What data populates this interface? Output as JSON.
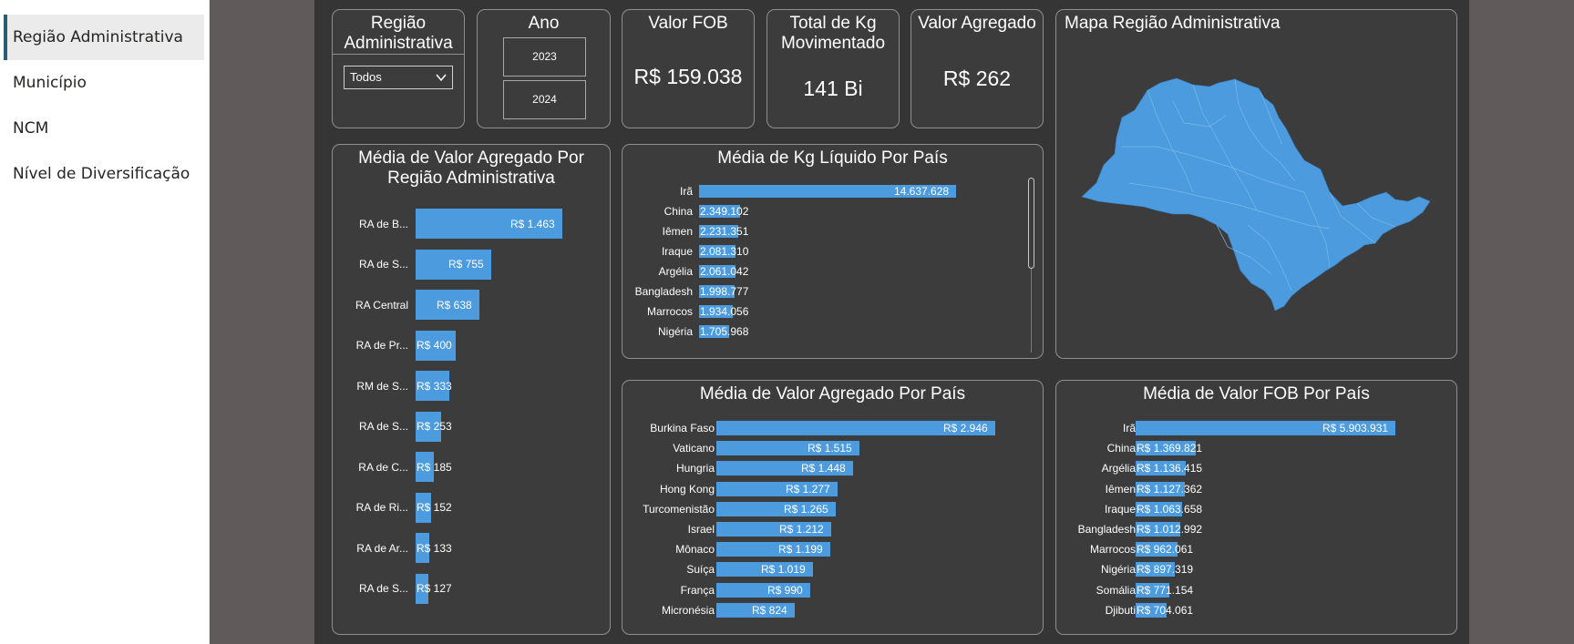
{
  "nav": {
    "items": [
      {
        "label": "Região Administrativa",
        "active": true
      },
      {
        "label": "Município"
      },
      {
        "label": "NCM"
      },
      {
        "label": "Nível de Diversificação"
      }
    ]
  },
  "slicers": {
    "regiao": {
      "title": "Região Administrativa",
      "selected": "Todos"
    },
    "ano": {
      "title": "Ano",
      "options": [
        "2023",
        "2024"
      ]
    }
  },
  "kpis": {
    "fob": {
      "title": "Valor FOB",
      "value": "R$ 159.038"
    },
    "kg": {
      "title": "Total de Kg Movimentado",
      "value": "141 Bi"
    },
    "agregado": {
      "title": "Valor Agregado",
      "value": "R$ 262"
    }
  },
  "map": {
    "title": "Mapa Região Administrativa",
    "fill_color": "#4b9bde"
  },
  "colors": {
    "bar": "#4b9bde",
    "canvas": "#353535",
    "card": "#3c3c3c"
  },
  "chart_data": [
    {
      "type": "bar",
      "orientation": "horizontal",
      "title": "Média de Valor Agregado Por Região Administrativa",
      "categories": [
        "RA de B...",
        "RA de S...",
        "RA Central",
        "RA de Pr...",
        "RM de S...",
        "RA de S...",
        "RA de C...",
        "RA de Ri...",
        "RA de Ar...",
        "RA de S..."
      ],
      "values": [
        1463,
        755,
        638,
        400,
        333,
        253,
        185,
        152,
        133,
        127
      ],
      "labels": [
        "R$ 1.463",
        "R$ 755",
        "R$ 638",
        "R$ 400",
        "R$ 333",
        "R$ 253",
        "R$ 185",
        "R$ 152",
        "R$ 133",
        "R$ 127"
      ]
    },
    {
      "type": "bar",
      "orientation": "horizontal",
      "title": "Média de Kg Líquido Por País",
      "categories": [
        "Irã",
        "China",
        "Iêmen",
        "Iraque",
        "Argélia",
        "Bangladesh",
        "Marrocos",
        "Nigéria"
      ],
      "values": [
        14637628,
        2349102,
        2231351,
        2081310,
        2061042,
        1998777,
        1934056,
        1705968
      ],
      "labels": [
        "14.637.628",
        "2.349.102",
        "2.231.351",
        "2.081.310",
        "2.061.042",
        "1.998.777",
        "1.934.056",
        "1.705.968"
      ]
    },
    {
      "type": "bar",
      "orientation": "horizontal",
      "title": "Média de Valor Agregado Por País",
      "categories": [
        "Burkina Faso",
        "Vaticano",
        "Hungria",
        "Hong Kong",
        "Turcomenistão",
        "Israel",
        "Mônaco",
        "Suíça",
        "França",
        "Micronésia"
      ],
      "values": [
        2946,
        1515,
        1448,
        1277,
        1265,
        1212,
        1199,
        1019,
        990,
        824
      ],
      "labels": [
        "R$ 2.946",
        "R$ 1.515",
        "R$ 1.448",
        "R$ 1.277",
        "R$ 1.265",
        "R$ 1.212",
        "R$ 1.199",
        "R$ 1.019",
        "R$ 990",
        "R$ 824"
      ]
    },
    {
      "type": "bar",
      "orientation": "horizontal",
      "title": "Média de Valor FOB Por País",
      "categories": [
        "Irã",
        "China",
        "Argélia",
        "Iêmen",
        "Iraque",
        "Bangladesh",
        "Marrocos",
        "Nigéria",
        "Somália",
        "Djibuti"
      ],
      "values": [
        5903931,
        1369821,
        1136415,
        1127362,
        1063658,
        1012992,
        962061,
        897319,
        771154,
        704061
      ],
      "labels": [
        "R$ 5.903.931",
        "R$ 1.369.821",
        "R$ 1.136.415",
        "R$ 1.127.362",
        "R$ 1.063.658",
        "R$ 1.012.992",
        "R$ 962.061",
        "R$ 897.319",
        "R$ 771.154",
        "R$ 704.061"
      ]
    }
  ]
}
